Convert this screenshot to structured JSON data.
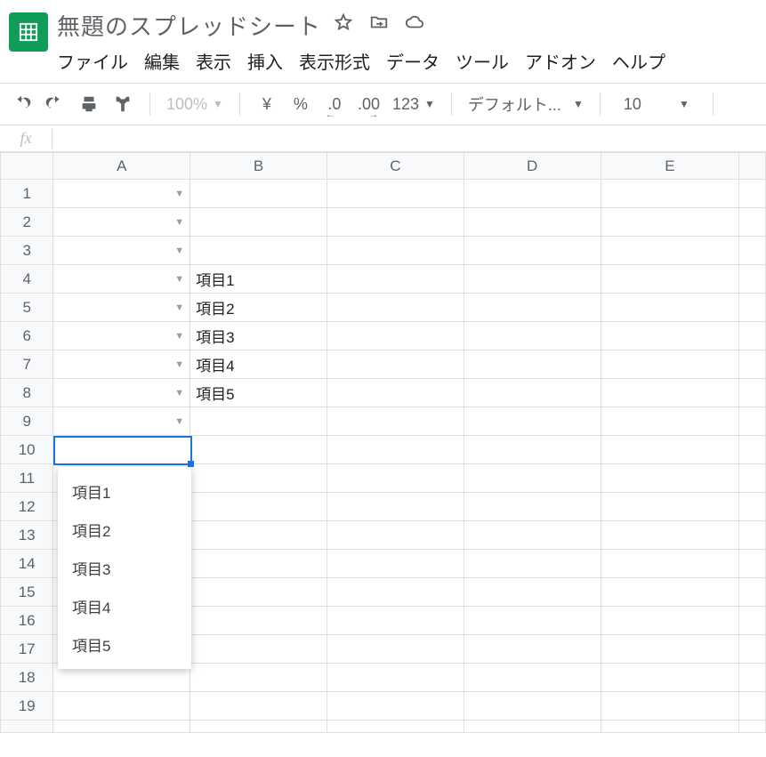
{
  "doc": {
    "title": "無題のスプレッドシート"
  },
  "menu": {
    "file": "ファイル",
    "edit": "編集",
    "view": "表示",
    "insert": "挿入",
    "format": "表示形式",
    "data": "データ",
    "tools": "ツール",
    "addons": "アドオン",
    "help": "ヘルプ"
  },
  "toolbar": {
    "zoom": "100%",
    "currency": "¥",
    "percent": "%",
    "dec_less": ".0",
    "dec_more": ".00",
    "num_format": "123",
    "font": "デフォルト...",
    "font_size": "10"
  },
  "fx": {
    "label": "fx",
    "value": ""
  },
  "columns": [
    "A",
    "B",
    "C",
    "D",
    "E"
  ],
  "rows": [
    "1",
    "2",
    "3",
    "4",
    "5",
    "6",
    "7",
    "8",
    "9",
    "10",
    "11",
    "12",
    "13",
    "14",
    "15",
    "16",
    "17",
    "18",
    "19"
  ],
  "cells": {
    "B4": "項目1",
    "B5": "項目2",
    "B6": "項目3",
    "B7": "項目4",
    "B8": "項目5"
  },
  "dv_rows": [
    1,
    2,
    3,
    4,
    5,
    6,
    7,
    8,
    9
  ],
  "active_cell": "A10",
  "dropdown": {
    "items": [
      "項目1",
      "項目2",
      "項目3",
      "項目4",
      "項目5"
    ]
  }
}
